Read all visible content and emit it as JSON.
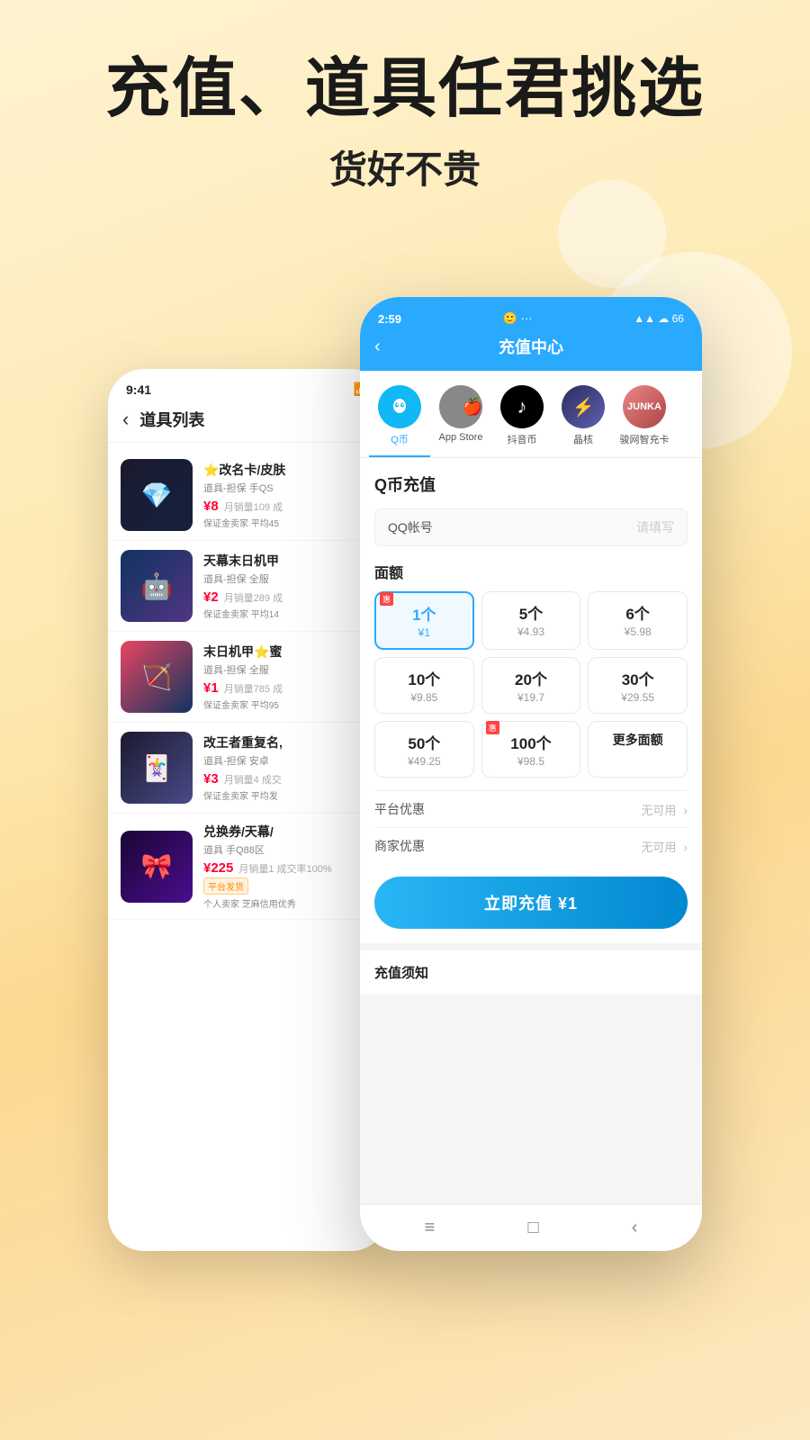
{
  "hero": {
    "title": "充值、道具任君挑选",
    "subtitle": "货好不贵"
  },
  "left_phone": {
    "status_time": "9:41",
    "back_label": "‹",
    "title": "道具列表",
    "items": [
      {
        "name": "⭐改名卡/皮肤",
        "tag": "道具-担保 手QS",
        "price": "¥8",
        "sales": "月销量109 成",
        "guarantee": "保证金卖家 平均45",
        "img_class": "item-img-1",
        "emoji": "💎"
      },
      {
        "name": "天幕末日机甲",
        "tag": "道具-担保 全服",
        "price": "¥2",
        "sales": "月销量289 成",
        "guarantee": "保证金卖家 平均14",
        "img_class": "item-img-2",
        "emoji": "🤖"
      },
      {
        "name": "末日机甲⭐蜜",
        "tag": "道具-担保 全服",
        "price": "¥1",
        "sales": "月销量785 成",
        "guarantee": "保证金卖家 平均95",
        "img_class": "item-img-3",
        "emoji": "🏹"
      },
      {
        "name": "改王者重复名,",
        "tag": "道具-担保 安卓",
        "price": "¥3",
        "sales": "月销量4 成交",
        "guarantee": "保证金卖家 平均发",
        "img_class": "item-img-4",
        "emoji": "🃏"
      },
      {
        "name": "兑换券/天幕/",
        "tag": "道具 手Q88区",
        "price": "¥225",
        "sales": "月销量1 成交率100%",
        "guarantee": "平台发货",
        "sub_guarantee": "个人卖家 芝麻信用优秀",
        "badge": "平台发货",
        "img_class": "item-img-5",
        "emoji": "🎀"
      }
    ]
  },
  "right_phone": {
    "status_time": "2:59",
    "status_dot": "🙂",
    "status_dots": "···",
    "title": "充值中心",
    "back_label": "‹",
    "tabs": [
      {
        "label": "Q币",
        "icon_char": "🐧",
        "icon_class": "tab-icon-qq",
        "active": true
      },
      {
        "label": "App Store",
        "icon_char": "",
        "icon_class": "tab-icon-apple",
        "active": false
      },
      {
        "label": "抖音币",
        "icon_char": "♪",
        "icon_class": "tab-icon-dy",
        "active": false
      },
      {
        "label": "晶核",
        "icon_char": "🎮",
        "icon_class": "tab-icon-jinghe",
        "active": false
      },
      {
        "label": "骏网智充卡",
        "icon_char": "骏卡",
        "icon_class": "tab-icon-junka",
        "active": false
      }
    ],
    "section_title": "Q币充值",
    "input_label": "QQ帐号",
    "input_placeholder": "请填写",
    "denom_title": "面额",
    "denominations": [
      {
        "qty": "1个",
        "price": "¥1",
        "active": true,
        "badge": true
      },
      {
        "qty": "5个",
        "price": "¥4.93",
        "active": false,
        "badge": false
      },
      {
        "qty": "6个",
        "price": "¥5.98",
        "active": false,
        "badge": false
      },
      {
        "qty": "10个",
        "price": "¥9.85",
        "active": false,
        "badge": false
      },
      {
        "qty": "20个",
        "price": "¥19.7",
        "active": false,
        "badge": false
      },
      {
        "qty": "30个",
        "price": "¥29.55",
        "active": false,
        "badge": false
      },
      {
        "qty": "50个",
        "price": "¥49.25",
        "active": false,
        "badge": false
      },
      {
        "qty": "100个",
        "price": "¥98.5",
        "active": false,
        "badge": true
      },
      {
        "qty": "更多面额",
        "price": "",
        "active": false,
        "badge": false
      }
    ],
    "platform_discount_label": "平台优惠",
    "platform_discount_val": "无可用",
    "merchant_discount_label": "商家优惠",
    "merchant_discount_val": "无可用",
    "cta_label": "立即充值 ¥1",
    "notice_title": "充值须知",
    "bottom_nav_icons": [
      "≡",
      "□",
      "‹"
    ]
  }
}
